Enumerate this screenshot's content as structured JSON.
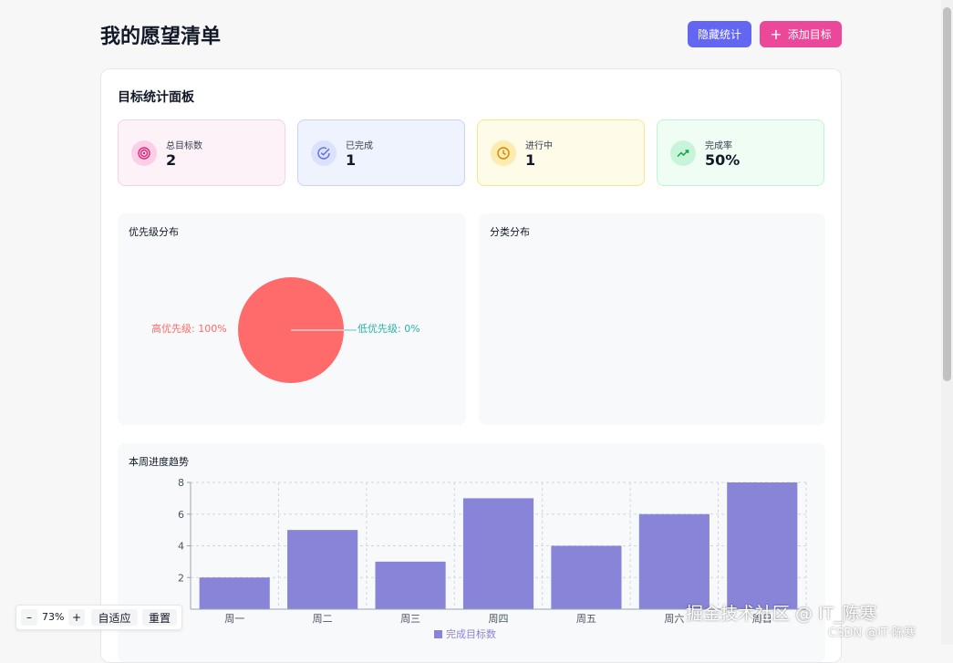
{
  "header": {
    "title": "我的愿望清单",
    "hide_stats_label": "隐藏统计",
    "add_goal_label": "添加目标",
    "add_icon": "plus-icon"
  },
  "stats_panel": {
    "title": "目标统计面板",
    "cards": [
      {
        "label": "总目标数",
        "value": "2",
        "icon": "target-icon",
        "color": "#db2777"
      },
      {
        "label": "已完成",
        "value": "1",
        "icon": "check-circle-icon",
        "color": "#6366f1"
      },
      {
        "label": "进行中",
        "value": "1",
        "icon": "clock-icon",
        "color": "#ca8a04"
      },
      {
        "label": "完成率",
        "value": "50%",
        "icon": "trending-up-icon",
        "color": "#16a34a"
      }
    ]
  },
  "priority_chart": {
    "title": "优先级分布",
    "high_label": "高优先级: 100%",
    "low_label": "低优先级: 0%"
  },
  "category_chart": {
    "title": "分类分布"
  },
  "weekly_chart": {
    "title": "本周进度趋势",
    "legend": "完成目标数"
  },
  "zoom_controls": {
    "minus": "–",
    "level": "73%",
    "plus": "+",
    "fit": "自适应",
    "reset": "重置"
  },
  "watermark": {
    "main": "掘金技术社区 @ IT_陈寒",
    "sub": "CSDN @IT·陈寒"
  },
  "chart_data": [
    {
      "type": "pie",
      "categories": [
        "高优先级",
        "低优先级"
      ],
      "values": [
        100,
        0
      ],
      "colors": [
        "#ff6b6b",
        "#4ecdc4"
      ]
    },
    {
      "type": "bar",
      "categories": [
        "周一",
        "周二",
        "周三",
        "周四",
        "周五",
        "周六",
        "周日"
      ],
      "series": [
        {
          "name": "完成目标数",
          "values": [
            2,
            5,
            3,
            7,
            4,
            6,
            8
          ]
        }
      ],
      "yticks": [
        2,
        4,
        6,
        8
      ],
      "ylim": [
        0,
        8
      ],
      "grid": true,
      "legend": "bottom",
      "color": "#8884d8"
    }
  ]
}
